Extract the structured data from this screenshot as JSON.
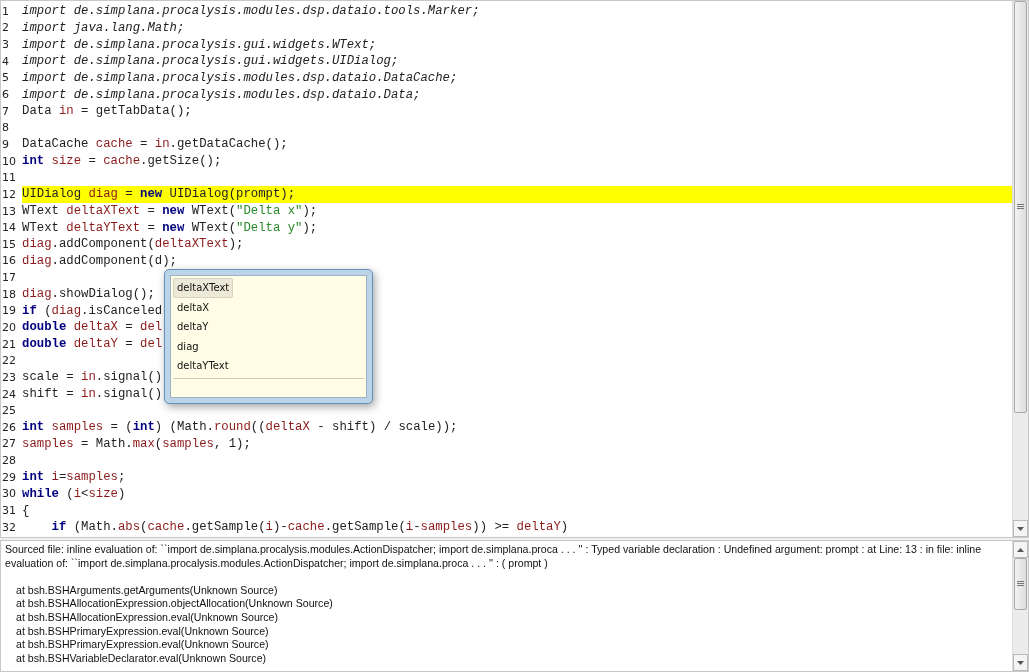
{
  "editor": {
    "lines": [
      {
        "number": "1",
        "highlighted": false,
        "tokens": [
          {
            "kind": "import",
            "text": "import de.simplana.procalysis.modules.dsp.dataio.tools.Marker;"
          }
        ]
      },
      {
        "number": "2",
        "highlighted": false,
        "tokens": [
          {
            "kind": "import",
            "text": "import java.lang.Math;"
          }
        ]
      },
      {
        "number": "3",
        "highlighted": false,
        "tokens": [
          {
            "kind": "import",
            "text": "import de.simplana.procalysis.gui.widgets.WText;"
          }
        ]
      },
      {
        "number": "4",
        "highlighted": false,
        "tokens": [
          {
            "kind": "import",
            "text": "import de.simplana.procalysis.gui.widgets.UIDialog;"
          }
        ]
      },
      {
        "number": "5",
        "highlighted": false,
        "tokens": [
          {
            "kind": "import",
            "text": "import de.simplana.procalysis.modules.dsp.dataio.DataCache;"
          }
        ]
      },
      {
        "number": "6",
        "highlighted": false,
        "tokens": [
          {
            "kind": "import",
            "text": "import de.simplana.procalysis.modules.dsp.dataio.Data;"
          }
        ]
      },
      {
        "number": "7",
        "highlighted": false,
        "tokens": [
          {
            "kind": "plain",
            "text": "Data "
          },
          {
            "kind": "var",
            "text": "in"
          },
          {
            "kind": "plain",
            "text": " = getTabData();"
          }
        ]
      },
      {
        "number": "8",
        "highlighted": false
      },
      {
        "number": "9",
        "highlighted": false,
        "tokens": [
          {
            "kind": "plain",
            "text": "DataCache "
          },
          {
            "kind": "var",
            "text": "cache"
          },
          {
            "kind": "plain",
            "text": " = "
          },
          {
            "kind": "var",
            "text": "in"
          },
          {
            "kind": "plain",
            "text": ".getDataCache();"
          }
        ]
      },
      {
        "number": "10",
        "highlighted": false,
        "tokens": [
          {
            "kind": "keyword",
            "text": "int"
          },
          {
            "kind": "var",
            "text": " size"
          },
          {
            "kind": "plain",
            "text": " = "
          },
          {
            "kind": "var",
            "text": "cache"
          },
          {
            "kind": "plain",
            "text": ".getSize();"
          }
        ]
      },
      {
        "number": "11",
        "highlighted": false
      },
      {
        "number": "12",
        "highlighted": true,
        "tokens": [
          {
            "kind": "plain",
            "text": "UIDialog "
          },
          {
            "kind": "var",
            "text": "diag"
          },
          {
            "kind": "plain",
            "text": " = "
          },
          {
            "kind": "keyword",
            "text": "new"
          },
          {
            "kind": "plain",
            "text": " UIDialog(prompt);"
          }
        ]
      },
      {
        "number": "13",
        "highlighted": false,
        "tokens": [
          {
            "kind": "plain",
            "text": "WText "
          },
          {
            "kind": "var",
            "text": "deltaXText"
          },
          {
            "kind": "plain",
            "text": " = "
          },
          {
            "kind": "keyword",
            "text": "new"
          },
          {
            "kind": "plain",
            "text": " WText("
          },
          {
            "kind": "string",
            "text": "\"Delta x\""
          },
          {
            "kind": "plain",
            "text": ");"
          }
        ]
      },
      {
        "number": "14",
        "highlighted": false,
        "tokens": [
          {
            "kind": "plain",
            "text": "WText "
          },
          {
            "kind": "var",
            "text": "deltaYText"
          },
          {
            "kind": "plain",
            "text": " = "
          },
          {
            "kind": "keyword",
            "text": "new"
          },
          {
            "kind": "plain",
            "text": " WText("
          },
          {
            "kind": "string",
            "text": "\"Delta y\""
          },
          {
            "kind": "plain",
            "text": ");"
          }
        ]
      },
      {
        "number": "15",
        "highlighted": false,
        "tokens": [
          {
            "kind": "var",
            "text": "diag"
          },
          {
            "kind": "plain",
            "text": ".addComponent("
          },
          {
            "kind": "var",
            "text": "deltaXText"
          },
          {
            "kind": "plain",
            "text": ");"
          }
        ]
      },
      {
        "number": "16",
        "highlighted": false,
        "tokens": [
          {
            "kind": "var",
            "text": "diag"
          },
          {
            "kind": "plain",
            "text": ".addComponent(d);"
          }
        ]
      },
      {
        "number": "17",
        "highlighted": false
      },
      {
        "number": "18",
        "highlighted": false,
        "tokens": [
          {
            "kind": "var",
            "text": "diag"
          },
          {
            "kind": "plain",
            "text": ".showDialog();"
          }
        ]
      },
      {
        "number": "19",
        "highlighted": false,
        "tokens": [
          {
            "kind": "keyword",
            "text": "if"
          },
          {
            "kind": "plain",
            "text": " ("
          },
          {
            "kind": "var",
            "text": "diag"
          },
          {
            "kind": "plain",
            "text": ".isCanceled"
          }
        ]
      },
      {
        "number": "20",
        "highlighted": false,
        "tokens": [
          {
            "kind": "keyword",
            "text": "double"
          },
          {
            "kind": "var",
            "text": " deltaX"
          },
          {
            "kind": "plain",
            "text": " = "
          },
          {
            "kind": "var",
            "text": "del"
          }
        ]
      },
      {
        "number": "21",
        "highlighted": false,
        "tokens": [
          {
            "kind": "keyword",
            "text": "double"
          },
          {
            "kind": "var",
            "text": " deltaY"
          },
          {
            "kind": "plain",
            "text": " = "
          },
          {
            "kind": "var",
            "text": "del"
          }
        ]
      },
      {
        "number": "22",
        "highlighted": false
      },
      {
        "number": "23",
        "highlighted": false,
        "tokens": [
          {
            "kind": "plain",
            "text": "scale = "
          },
          {
            "kind": "var",
            "text": "in"
          },
          {
            "kind": "plain",
            "text": ".signal()"
          }
        ]
      },
      {
        "number": "24",
        "highlighted": false,
        "tokens": [
          {
            "kind": "plain",
            "text": "shift = "
          },
          {
            "kind": "var",
            "text": "in"
          },
          {
            "kind": "plain",
            "text": ".signal()"
          }
        ]
      },
      {
        "number": "25",
        "highlighted": false
      },
      {
        "number": "26",
        "highlighted": false,
        "tokens": [
          {
            "kind": "keyword",
            "text": "int"
          },
          {
            "kind": "var",
            "text": " samples"
          },
          {
            "kind": "plain",
            "text": " = ("
          },
          {
            "kind": "keyword",
            "text": "int"
          },
          {
            "kind": "plain",
            "text": ") (Math."
          },
          {
            "kind": "var",
            "text": "round"
          },
          {
            "kind": "plain",
            "text": "(("
          },
          {
            "kind": "var",
            "text": "deltaX"
          },
          {
            "kind": "plain",
            "text": " - shift) / scale));"
          }
        ]
      },
      {
        "number": "27",
        "highlighted": false,
        "tokens": [
          {
            "kind": "var",
            "text": "samples"
          },
          {
            "kind": "plain",
            "text": " = Math."
          },
          {
            "kind": "var",
            "text": "max"
          },
          {
            "kind": "plain",
            "text": "("
          },
          {
            "kind": "var",
            "text": "samples"
          },
          {
            "kind": "plain",
            "text": ", 1);"
          }
        ]
      },
      {
        "number": "28",
        "highlighted": false
      },
      {
        "number": "29",
        "highlighted": false,
        "tokens": [
          {
            "kind": "keyword",
            "text": "int"
          },
          {
            "kind": "var",
            "text": " i"
          },
          {
            "kind": "plain",
            "text": "="
          },
          {
            "kind": "var",
            "text": "samples"
          },
          {
            "kind": "plain",
            "text": ";"
          }
        ]
      },
      {
        "number": "30",
        "highlighted": false,
        "tokens": [
          {
            "kind": "keyword",
            "text": "while"
          },
          {
            "kind": "plain",
            "text": " ("
          },
          {
            "kind": "var",
            "text": "i"
          },
          {
            "kind": "plain",
            "text": "<"
          },
          {
            "kind": "var",
            "text": "size"
          },
          {
            "kind": "plain",
            "text": ")"
          }
        ]
      },
      {
        "number": "31",
        "highlighted": false,
        "tokens": [
          {
            "kind": "plain",
            "text": "{"
          }
        ]
      },
      {
        "number": "32",
        "highlighted": false,
        "tokens": [
          {
            "kind": "keyword",
            "text": "    if"
          },
          {
            "kind": "plain",
            "text": " (Math."
          },
          {
            "kind": "var",
            "text": "abs"
          },
          {
            "kind": "plain",
            "text": "("
          },
          {
            "kind": "var",
            "text": "cache"
          },
          {
            "kind": "plain",
            "text": ".getSample("
          },
          {
            "kind": "var",
            "text": "i"
          },
          {
            "kind": "plain",
            "text": ")-"
          },
          {
            "kind": "var",
            "text": "cache"
          },
          {
            "kind": "plain",
            "text": ".getSample("
          },
          {
            "kind": "var",
            "text": "i"
          },
          {
            "kind": "plain",
            "text": "-"
          },
          {
            "kind": "var",
            "text": "samples"
          },
          {
            "kind": "plain",
            "text": ")) >= "
          },
          {
            "kind": "var",
            "text": "deltaY"
          },
          {
            "kind": "plain",
            "text": ")"
          }
        ]
      }
    ]
  },
  "completion": {
    "items": [
      {
        "label": "deltaXText",
        "selected": true
      },
      {
        "label": "deltaX",
        "selected": false
      },
      {
        "label": "deltaY",
        "selected": false
      },
      {
        "label": "diag",
        "selected": false
      },
      {
        "label": "deltaYText",
        "selected": false
      }
    ]
  },
  "console": {
    "message": "Sourced file: inline evaluation of: ``import de.simplana.procalysis.modules.ActionDispatcher; import de.simplana.proca . . . '' : Typed variable declaration : Undefined argument: prompt  : at Line: 13 : in file: inline evaluation of: ``import de.simplana.procalysis.modules.ActionDispatcher; import de.simplana.proca . . . '' : ( prompt )",
    "trace": [
      "at bsh.BSHArguments.getArguments(Unknown Source)",
      "at bsh.BSHAllocationExpression.objectAllocation(Unknown Source)",
      "at bsh.BSHAllocationExpression.eval(Unknown Source)",
      "at bsh.BSHPrimaryExpression.eval(Unknown Source)",
      "at bsh.BSHPrimaryExpression.eval(Unknown Source)",
      "at bsh.BSHVariableDeclarator.eval(Unknown Source)"
    ]
  }
}
